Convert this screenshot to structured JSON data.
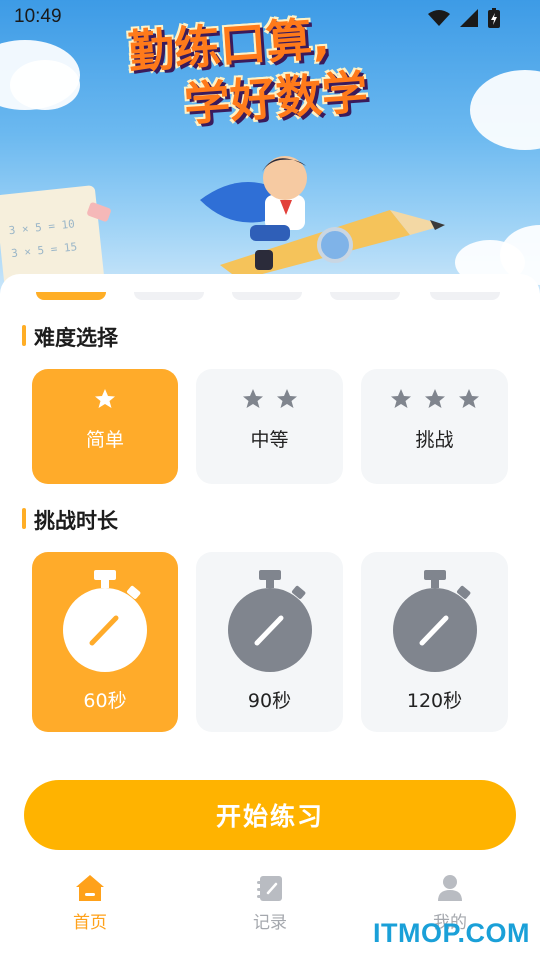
{
  "status_bar": {
    "time": "10:49"
  },
  "hero": {
    "title_line1": "勤练口算,",
    "title_line2": "学好数学",
    "book_line1": "3 × 5 = 10",
    "book_line2": "3 × 5 = 15"
  },
  "difficulty": {
    "title": "难度选择",
    "options": [
      {
        "label": "简单",
        "stars": 1,
        "selected": true
      },
      {
        "label": "中等",
        "stars": 2,
        "selected": false
      },
      {
        "label": "挑战",
        "stars": 3,
        "selected": false
      }
    ]
  },
  "duration": {
    "title": "挑战时长",
    "options": [
      {
        "label": "60秒",
        "selected": true
      },
      {
        "label": "90秒",
        "selected": false
      },
      {
        "label": "120秒",
        "selected": false
      }
    ]
  },
  "start_button": {
    "label": "开始练习"
  },
  "tabbar": {
    "items": [
      {
        "label": "首页",
        "icon": "home-icon",
        "active": true
      },
      {
        "label": "记录",
        "icon": "notebook-icon",
        "active": false
      },
      {
        "label": "我的",
        "icon": "person-icon",
        "active": false
      }
    ]
  },
  "watermark": "ITMOP.COM",
  "colors": {
    "accent": "#ffab2a",
    "button": "#ffb300",
    "inactive_card": "#f4f6f8",
    "icon_gray": "#80858e"
  }
}
